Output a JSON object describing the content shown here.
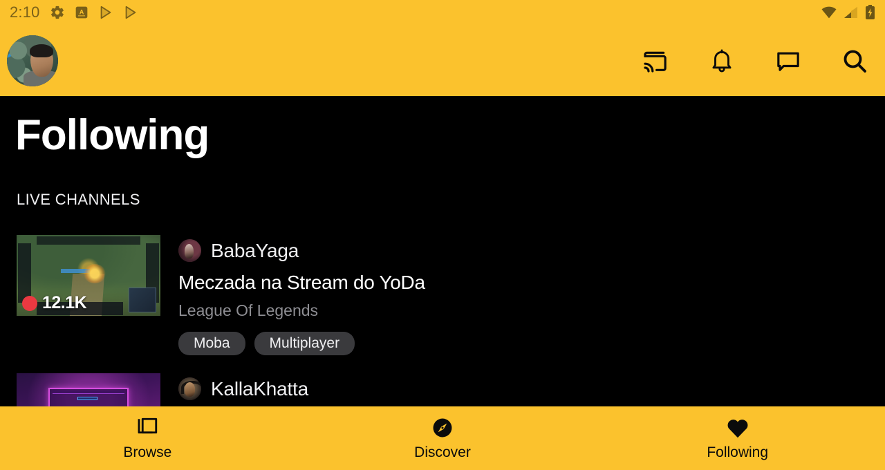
{
  "theme": {
    "brand_yellow": "#FBC22D",
    "background": "#000000",
    "text_primary": "#FFFFFF",
    "text_secondary": "#8E8E93",
    "tag_background": "#3A3A3D",
    "live_red": "#EB3941",
    "status_icon_tint": "#7A6018"
  },
  "status_bar": {
    "time": "2:10",
    "left_icons": [
      "gear-icon",
      "a-badge-icon",
      "play-store-icon",
      "play-store-icon"
    ],
    "right_icons": [
      "wifi-icon",
      "cellular-signal-icon",
      "battery-charging-icon"
    ]
  },
  "app_bar": {
    "avatar_name": "user-avatar",
    "actions": [
      {
        "name": "cast-icon",
        "label": "Cast"
      },
      {
        "name": "notifications-bell-icon",
        "label": "Notifications"
      },
      {
        "name": "whispers-chat-icon",
        "label": "Whispers"
      },
      {
        "name": "search-icon",
        "label": "Search"
      }
    ]
  },
  "page": {
    "title": "Following",
    "section_header": "LIVE CHANNELS"
  },
  "streams": [
    {
      "channel": "BabaYaga",
      "title": "Meczada na Stream do YoDa",
      "game": "League Of Legends",
      "viewers": "12.1K",
      "tags": [
        "Moba",
        "Multiplayer"
      ]
    },
    {
      "channel": "KallaKhatta",
      "title": "",
      "game": "",
      "viewers": "",
      "tags": []
    }
  ],
  "bottom_nav": {
    "items": [
      {
        "label": "Browse",
        "icon": "collections-icon",
        "active": false
      },
      {
        "label": "Discover",
        "icon": "compass-icon",
        "active": false
      },
      {
        "label": "Following",
        "icon": "heart-icon",
        "active": true
      }
    ]
  }
}
